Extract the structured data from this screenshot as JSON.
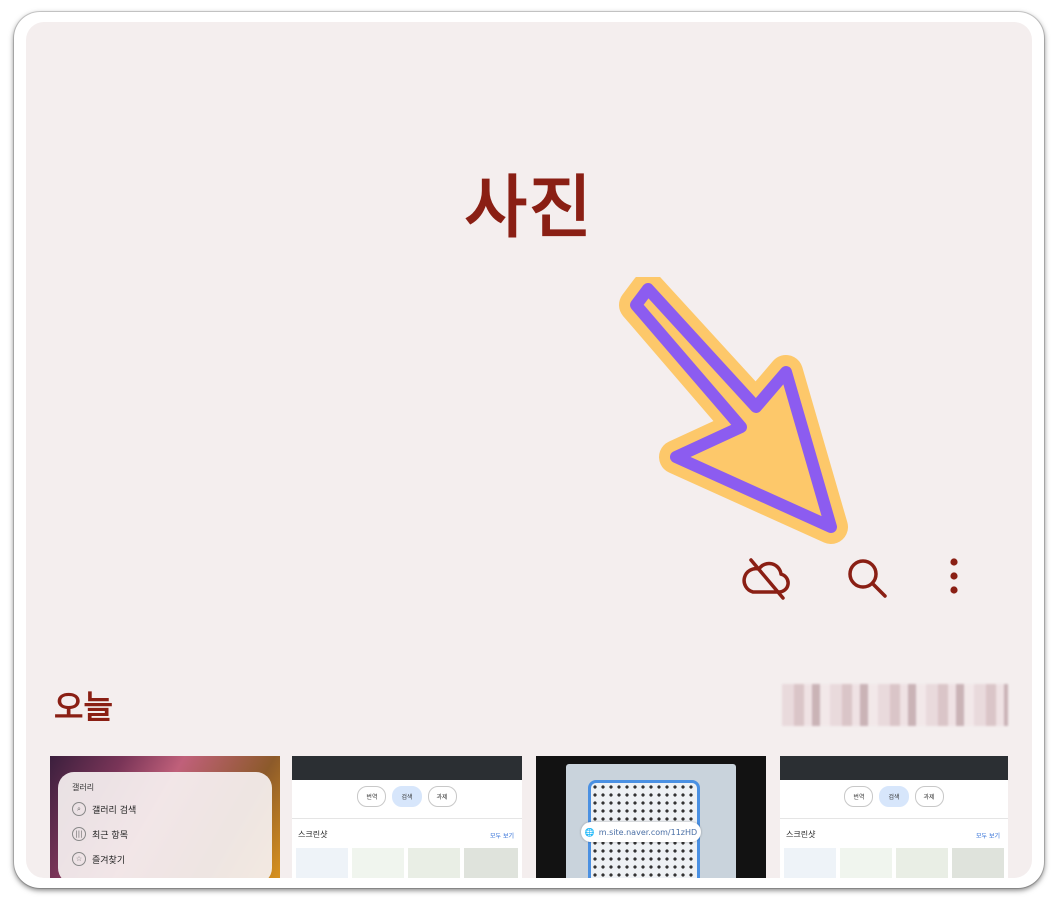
{
  "header": {
    "title": "사진"
  },
  "toolbar": {
    "icons": [
      "cloud-off-icon",
      "search-icon",
      "more-vert-icon"
    ]
  },
  "section": {
    "title": "오늘"
  },
  "colors": {
    "accent": "#8a1f14",
    "background": "#f4eeee",
    "arrow_fill": "#fdc86a",
    "arrow_stroke": "#8c5cf0"
  },
  "thumbnails": {
    "t1": {
      "panel_title": "갤러리",
      "rows": [
        "갤러리 검색",
        "최근 항목",
        "즐겨찾기"
      ]
    },
    "t2": {
      "chips": [
        "번역",
        "검색",
        "과제"
      ],
      "label": "스크린샷",
      "all": "모두 보기"
    },
    "t3": {
      "url": "m.site.naver.com/11zHD"
    },
    "t4": {
      "chips": [
        "번역",
        "검색",
        "과제"
      ],
      "label": "스크린샷",
      "all": "모두 보기"
    }
  }
}
